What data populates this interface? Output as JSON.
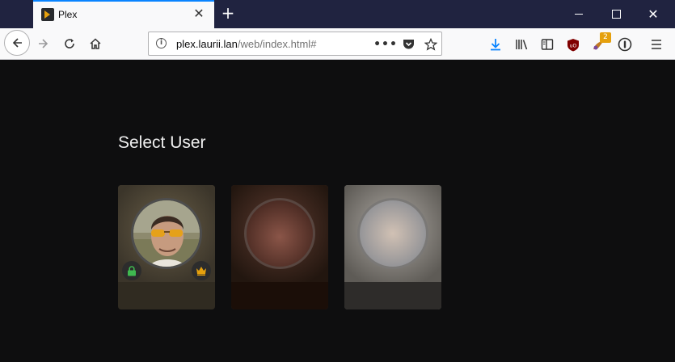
{
  "browser": {
    "tab": {
      "title": "Plex"
    },
    "url": {
      "host": "plex.laurii.lan",
      "path": "/web/index.html#"
    },
    "extension_badge": "2"
  },
  "page": {
    "heading": "Select User",
    "users": [
      {
        "avatar": "user photo",
        "locked": true,
        "admin": true
      },
      {
        "avatar": "blurred",
        "locked": false,
        "admin": false
      },
      {
        "avatar": "blurred",
        "locked": false,
        "admin": false
      }
    ],
    "colors": {
      "lock": "#3fb950",
      "admin": "#e5a00d",
      "accent": "#0a84ff"
    }
  }
}
